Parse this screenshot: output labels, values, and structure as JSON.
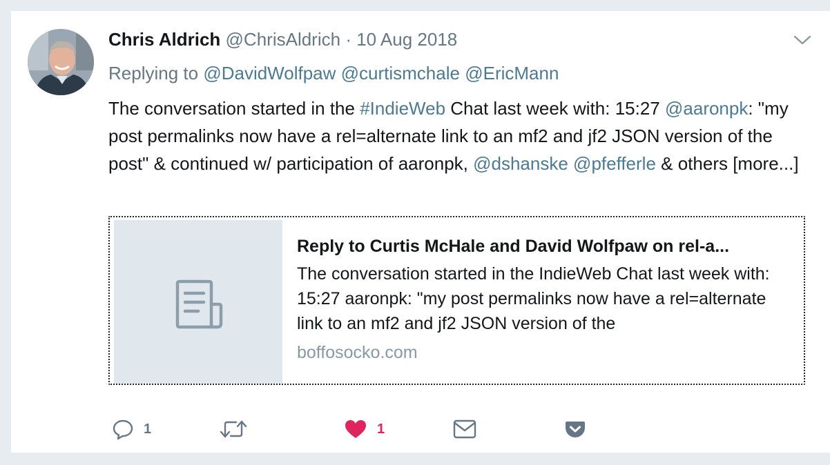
{
  "tweet": {
    "author": {
      "fullname": "Chris Aldrich",
      "handle": "@ChrisAldrich",
      "separator": "·",
      "date": "10 Aug 2018"
    },
    "replying": {
      "prefix": "Replying to",
      "mentions": [
        "@DavidWolfpaw",
        "@curtismchale",
        "@EricMann"
      ]
    },
    "text": {
      "p1": "The conversation started in the ",
      "hashtag": "#IndieWeb",
      "p2": " Chat last week with: 15:27 ",
      "m1": "@aaronpk",
      "p3": ": \"my post permalinks now have a rel=alternate link to an mf2 and jf2 JSON version of the post\" & continued w/ participation of aaronpk, ",
      "m2": "@dshanske",
      "m3": "@pfefferle",
      "p4": " & others ",
      "more": "[more...]"
    },
    "card": {
      "title": "Reply to Curtis McHale and David Wolfpaw on rel-a...",
      "description": "The conversation started in the IndieWeb Chat last week with: 15:27 aaronpk: \"my post permalinks now have a rel=alternate link to an mf2 and jf2 JSON version of the",
      "domain": "boffosocko.com",
      "thumb_icon": "document-icon"
    },
    "actions": {
      "reply_count": "1",
      "retweet_count": "",
      "like_count": "1",
      "icons": [
        "reply-icon",
        "retweet-icon",
        "heart-icon",
        "direct-message-icon",
        "pocket-icon"
      ]
    },
    "colors": {
      "link": "#4a7a94",
      "muted": "#657786",
      "like": "#e0245e",
      "background": "#e6ecf0"
    }
  }
}
